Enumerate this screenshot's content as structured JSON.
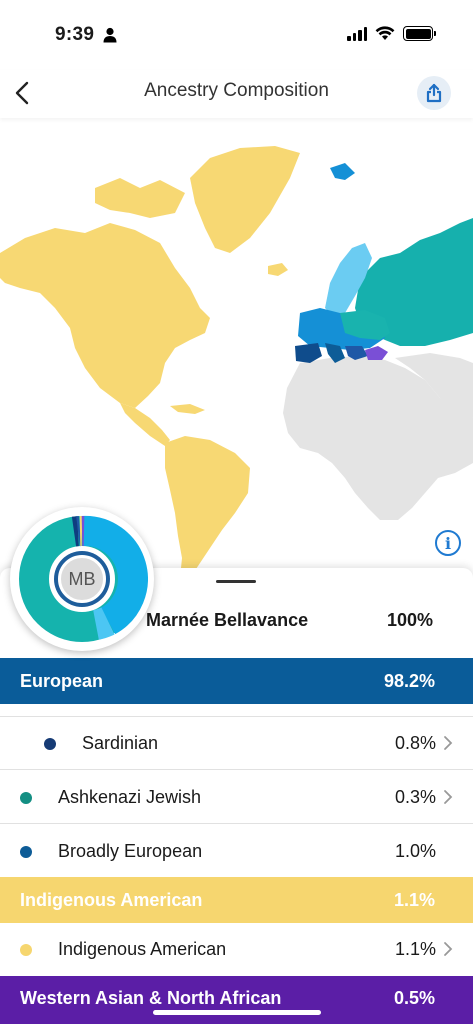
{
  "status": {
    "time": "9:39"
  },
  "nav": {
    "title": "Ancestry Composition"
  },
  "profile": {
    "initials": "MB",
    "name": "Marnée Bellavance",
    "percent": "100%"
  },
  "colors": {
    "european": "#0a5c99",
    "indigenous": "#f6d66f",
    "western_asian": "#5b1ea6",
    "sardinian_dot": "#163b75",
    "ashkenazi_dot": "#148f83",
    "broadly_dot": "#0d5c97",
    "indigenous_dot": "#f6d66f"
  },
  "groups": [
    {
      "label": "European",
      "percent": "98.2%"
    },
    {
      "label": "Indigenous American",
      "percent": "1.1%"
    },
    {
      "label": "Western Asian & North African",
      "percent": "0.5%"
    }
  ],
  "rows": [
    {
      "label": "Sardinian",
      "percent": "0.8%"
    },
    {
      "label": "Ashkenazi Jewish",
      "percent": "0.3%"
    },
    {
      "label": "Broadly European",
      "percent": "1.0%"
    },
    {
      "label": "Indigenous American",
      "percent": "1.1%"
    }
  ]
}
